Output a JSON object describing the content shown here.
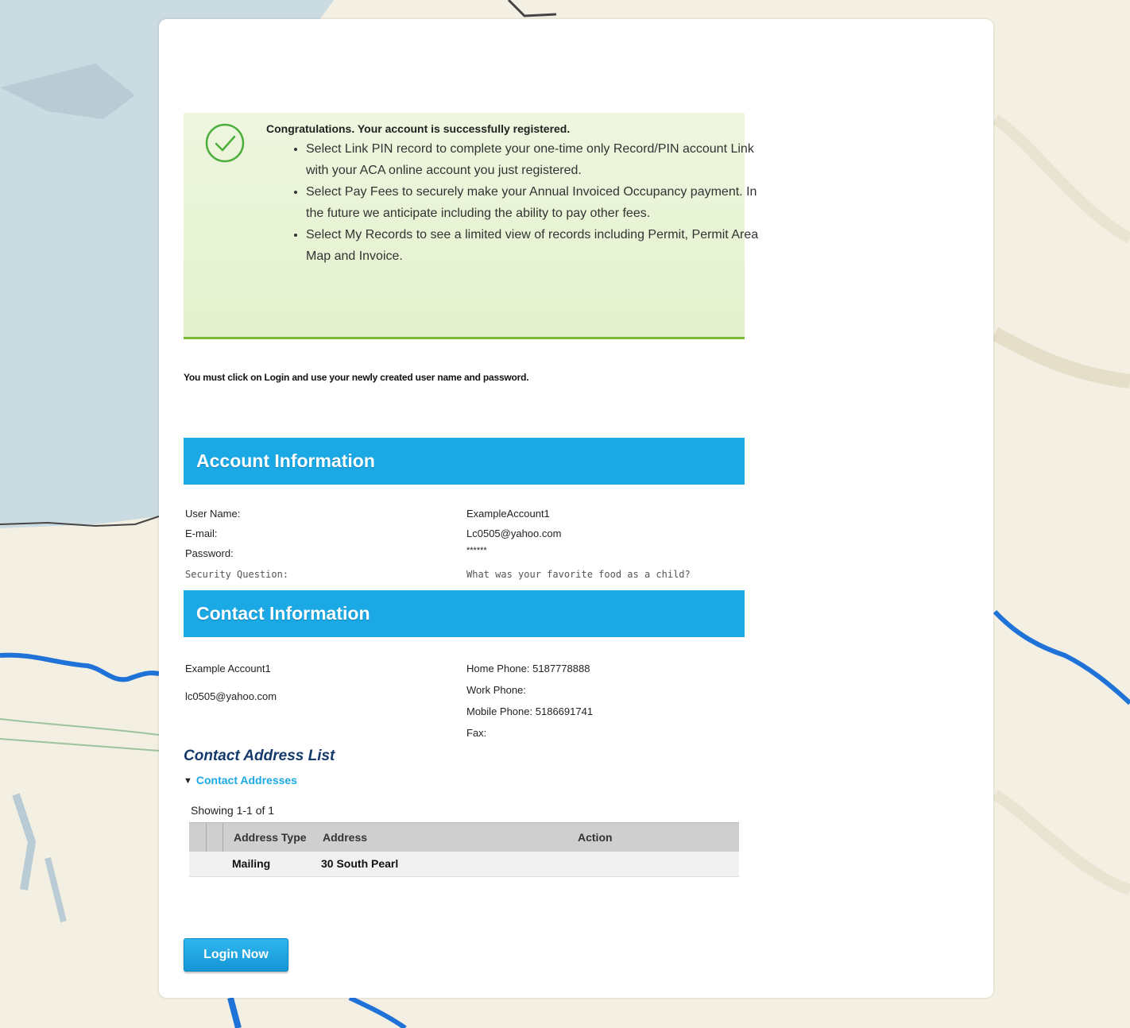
{
  "success": {
    "title": "Congratulations. Your account is successfully registered.",
    "items": [
      "Select Link PIN record to complete your one-time only Record/PIN account Link with your ACA online account you just registered.",
      "Select Pay Fees to securely make your Annual Invoiced Occupancy payment. In the future we anticipate including the ability to pay other fees.",
      "Select My Records to see a limited view of records including Permit, Permit Area Map and Invoice."
    ]
  },
  "notice": "You must click on Login and use your newly created user name and password.",
  "account": {
    "header": "Account Information",
    "user_name_label": "User Name:",
    "user_name": "ExampleAccount1",
    "email_label": "E-mail:",
    "email": "Lc0505@yahoo.com",
    "password_label": "Password:",
    "password": "******",
    "security_question_label": "Security Question:",
    "security_question": "What was your favorite food as a child?"
  },
  "contact": {
    "header": "Contact Information",
    "name": "Example Account1",
    "email": "lc0505@yahoo.com",
    "home_phone_label": "Home Phone:",
    "home_phone": "5187778888",
    "work_phone_label": "Work Phone:",
    "work_phone": "",
    "mobile_phone_label": "Mobile Phone:",
    "mobile_phone": "5186691741",
    "fax_label": "Fax:",
    "fax": ""
  },
  "address_list": {
    "title": "Contact Address List",
    "toggle_label": "Contact Addresses",
    "showing": "Showing 1-1 of 1",
    "columns": [
      "Address Type",
      "Address",
      "Action"
    ],
    "rows": [
      {
        "type": "Mailing",
        "address": "30 South Pearl",
        "action": ""
      }
    ]
  },
  "login_button": "Login Now",
  "colors": {
    "section_header": "#1ba9e6",
    "success_bg": "#e8f4d6",
    "success_border": "#7ab935",
    "button": "#1ba9e6"
  },
  "icons": {
    "success": "check-circle-icon",
    "toggle": "caret-down-icon"
  }
}
